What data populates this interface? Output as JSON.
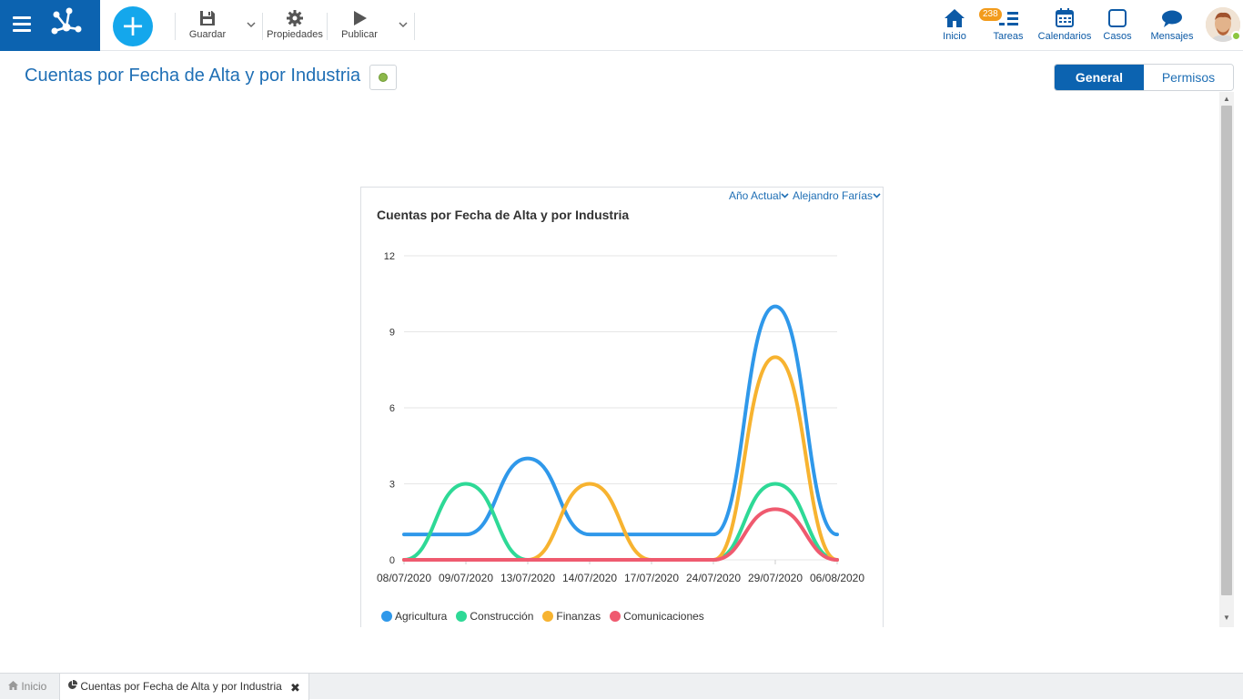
{
  "toolbar": {
    "save_label": "Guardar",
    "properties_label": "Propiedades",
    "publish_label": "Publicar"
  },
  "nav": {
    "home_label": "Inicio",
    "tasks_label": "Tareas",
    "tasks_badge": "238",
    "calendars_label": "Calendarios",
    "cases_label": "Casos",
    "messages_label": "Mensajes"
  },
  "page": {
    "title": "Cuentas por Fecha de Alta y por Industria",
    "tabs": [
      {
        "label": "General",
        "active": true
      },
      {
        "label": "Permisos",
        "active": false
      }
    ]
  },
  "filters": {
    "period": "Año Actual",
    "user": "Alejandro Farías"
  },
  "colors": {
    "brand": "#0c63b0",
    "accent": "#14a7ec",
    "agricultura": "#2f98ea",
    "construccion": "#2ed996",
    "finanzas": "#f7b330",
    "comunicaciones": "#ef5a6f"
  },
  "chart_data": {
    "type": "line",
    "title": "Cuentas por Fecha de Alta y por Industria",
    "xlabel": "",
    "ylabel": "",
    "categories": [
      "08/07/2020",
      "09/07/2020",
      "13/07/2020",
      "14/07/2020",
      "17/07/2020",
      "24/07/2020",
      "29/07/2020",
      "06/08/2020"
    ],
    "ylim": [
      0,
      12
    ],
    "yticks": [
      0,
      3,
      6,
      9,
      12
    ],
    "grid": true,
    "smooth": true,
    "legend_position": "bottom-left",
    "series": [
      {
        "name": "Agricultura",
        "values": [
          1,
          1,
          4,
          1,
          1,
          1,
          10,
          1
        ]
      },
      {
        "name": "Construcción",
        "values": [
          0,
          3,
          0,
          0,
          0,
          0,
          3,
          0
        ]
      },
      {
        "name": "Finanzas",
        "values": [
          0,
          0,
          0,
          3,
          0,
          0,
          8,
          0
        ]
      },
      {
        "name": "Comunicaciones",
        "values": [
          0,
          0,
          0,
          0,
          0,
          0,
          2,
          0
        ]
      }
    ]
  },
  "bottom_tabs": {
    "home_label": "Inicio",
    "current_label": "Cuentas por Fecha de Alta y por Industria"
  }
}
